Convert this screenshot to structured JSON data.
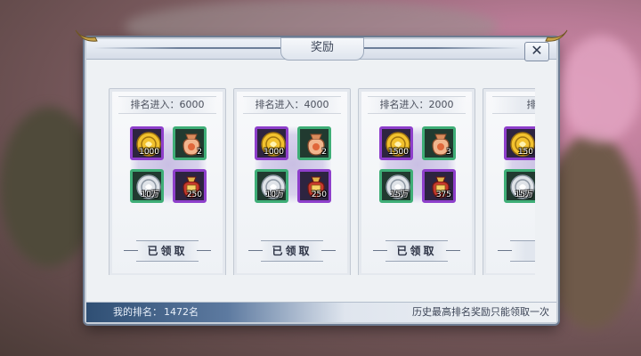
{
  "dialog": {
    "title": "奖励",
    "close_label": "✕"
  },
  "cards": [
    {
      "rank_label": "排名进入：6000",
      "items": [
        {
          "icon": "gold-coin",
          "frame": "purple",
          "qty": "1000"
        },
        {
          "icon": "fortune-bag",
          "frame": "green",
          "qty": "2"
        },
        {
          "icon": "silver-coin",
          "frame": "green",
          "qty": "10万"
        },
        {
          "icon": "red-treasure-bag",
          "frame": "purple",
          "qty": "250"
        }
      ],
      "claim_label": "已领取"
    },
    {
      "rank_label": "排名进入：4000",
      "items": [
        {
          "icon": "gold-coin",
          "frame": "purple",
          "qty": "1000"
        },
        {
          "icon": "fortune-bag",
          "frame": "green",
          "qty": "2"
        },
        {
          "icon": "silver-coin",
          "frame": "green",
          "qty": "10万"
        },
        {
          "icon": "red-treasure-bag",
          "frame": "purple",
          "qty": "250"
        }
      ],
      "claim_label": "已领取"
    },
    {
      "rank_label": "排名进入：2000",
      "items": [
        {
          "icon": "gold-coin",
          "frame": "purple",
          "qty": "1500"
        },
        {
          "icon": "fortune-bag",
          "frame": "green",
          "qty": "3"
        },
        {
          "icon": "silver-coin",
          "frame": "green",
          "qty": "15万"
        },
        {
          "icon": "red-treasure-bag",
          "frame": "purple",
          "qty": "375"
        }
      ],
      "claim_label": "已领取"
    },
    {
      "rank_label": "排名进",
      "items": [
        {
          "icon": "gold-coin",
          "frame": "purple",
          "qty": "150"
        },
        {
          "icon": "fortune-bag",
          "frame": "green",
          "qty": ""
        },
        {
          "icon": "silver-coin",
          "frame": "green",
          "qty": "15万"
        },
        {
          "icon": "red-treasure-bag",
          "frame": "purple",
          "qty": ""
        }
      ],
      "claim_label": "已"
    }
  ],
  "footer": {
    "my_rank_label": "我的排名：",
    "my_rank_value": "1472名",
    "notice": "历史最高排名奖励只能领取一次"
  },
  "colors": {
    "purple_frame": "#8e3fcb",
    "green_frame": "#3fae77",
    "gold": "#f2c22e"
  }
}
